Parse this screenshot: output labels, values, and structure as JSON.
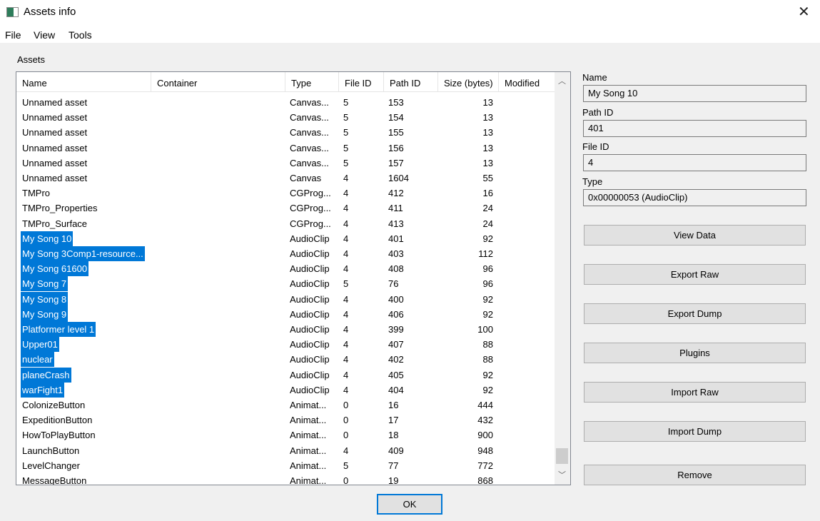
{
  "window": {
    "title": "Assets info",
    "close": "✕"
  },
  "menu": [
    "File",
    "View",
    "Tools"
  ],
  "group_label": "Assets",
  "columns": [
    "Name",
    "Container",
    "Type",
    "File ID",
    "Path ID",
    "Size (bytes)",
    "Modified"
  ],
  "rows": [
    {
      "name": "Unnamed asset",
      "container": "",
      "type": "Canvas...",
      "file_id": "5",
      "path_id": "153",
      "size": "13",
      "modified": "",
      "selected": false
    },
    {
      "name": "Unnamed asset",
      "container": "",
      "type": "Canvas...",
      "file_id": "5",
      "path_id": "154",
      "size": "13",
      "modified": "",
      "selected": false
    },
    {
      "name": "Unnamed asset",
      "container": "",
      "type": "Canvas...",
      "file_id": "5",
      "path_id": "155",
      "size": "13",
      "modified": "",
      "selected": false
    },
    {
      "name": "Unnamed asset",
      "container": "",
      "type": "Canvas...",
      "file_id": "5",
      "path_id": "156",
      "size": "13",
      "modified": "",
      "selected": false
    },
    {
      "name": "Unnamed asset",
      "container": "",
      "type": "Canvas...",
      "file_id": "5",
      "path_id": "157",
      "size": "13",
      "modified": "",
      "selected": false
    },
    {
      "name": "Unnamed asset",
      "container": "",
      "type": "Canvas",
      "file_id": "4",
      "path_id": "1604",
      "size": "55",
      "modified": "",
      "selected": false
    },
    {
      "name": "TMPro",
      "container": "",
      "type": "CGProg...",
      "file_id": "4",
      "path_id": "412",
      "size": "16",
      "modified": "",
      "selected": false
    },
    {
      "name": "TMPro_Properties",
      "container": "",
      "type": "CGProg...",
      "file_id": "4",
      "path_id": "411",
      "size": "24",
      "modified": "",
      "selected": false
    },
    {
      "name": "TMPro_Surface",
      "container": "",
      "type": "CGProg...",
      "file_id": "4",
      "path_id": "413",
      "size": "24",
      "modified": "",
      "selected": false
    },
    {
      "name": "My Song 10",
      "container": "",
      "type": "AudioClip",
      "file_id": "4",
      "path_id": "401",
      "size": "92",
      "modified": "",
      "selected": true
    },
    {
      "name": "My Song 3Comp1-resource...",
      "container": "",
      "type": "AudioClip",
      "file_id": "4",
      "path_id": "403",
      "size": "112",
      "modified": "",
      "selected": true
    },
    {
      "name": "My Song 61600",
      "container": "",
      "type": "AudioClip",
      "file_id": "4",
      "path_id": "408",
      "size": "96",
      "modified": "",
      "selected": true
    },
    {
      "name": "My Song 7",
      "container": "",
      "type": "AudioClip",
      "file_id": "5",
      "path_id": "76",
      "size": "96",
      "modified": "",
      "selected": true
    },
    {
      "name": "My Song 8",
      "container": "",
      "type": "AudioClip",
      "file_id": "4",
      "path_id": "400",
      "size": "92",
      "modified": "",
      "selected": true
    },
    {
      "name": "My Song 9",
      "container": "",
      "type": "AudioClip",
      "file_id": "4",
      "path_id": "406",
      "size": "92",
      "modified": "",
      "selected": true
    },
    {
      "name": "Platformer level 1",
      "container": "",
      "type": "AudioClip",
      "file_id": "4",
      "path_id": "399",
      "size": "100",
      "modified": "",
      "selected": true
    },
    {
      "name": "Upper01",
      "container": "",
      "type": "AudioClip",
      "file_id": "4",
      "path_id": "407",
      "size": "88",
      "modified": "",
      "selected": true
    },
    {
      "name": "nuclear",
      "container": "",
      "type": "AudioClip",
      "file_id": "4",
      "path_id": "402",
      "size": "88",
      "modified": "",
      "selected": true
    },
    {
      "name": "planeCrash",
      "container": "",
      "type": "AudioClip",
      "file_id": "4",
      "path_id": "405",
      "size": "92",
      "modified": "",
      "selected": true
    },
    {
      "name": "warFight1",
      "container": "",
      "type": "AudioClip",
      "file_id": "4",
      "path_id": "404",
      "size": "92",
      "modified": "",
      "selected": true
    },
    {
      "name": "ColonizeButton",
      "container": "",
      "type": "Animat...",
      "file_id": "0",
      "path_id": "16",
      "size": "444",
      "modified": "",
      "selected": false
    },
    {
      "name": "ExpeditionButton",
      "container": "",
      "type": "Animat...",
      "file_id": "0",
      "path_id": "17",
      "size": "432",
      "modified": "",
      "selected": false
    },
    {
      "name": "HowToPlayButton",
      "container": "",
      "type": "Animat...",
      "file_id": "0",
      "path_id": "18",
      "size": "900",
      "modified": "",
      "selected": false
    },
    {
      "name": "LaunchButton",
      "container": "",
      "type": "Animat...",
      "file_id": "4",
      "path_id": "409",
      "size": "948",
      "modified": "",
      "selected": false
    },
    {
      "name": "LevelChanger",
      "container": "",
      "type": "Animat...",
      "file_id": "5",
      "path_id": "77",
      "size": "772",
      "modified": "",
      "selected": false
    },
    {
      "name": "MessageButton",
      "container": "",
      "type": "Animat...",
      "file_id": "0",
      "path_id": "19",
      "size": "868",
      "modified": "",
      "selected": false
    }
  ],
  "details": {
    "name_label": "Name",
    "name_value": "My Song 10",
    "path_label": "Path ID",
    "path_value": "401",
    "file_label": "File ID",
    "file_value": "4",
    "type_label": "Type",
    "type_value": "0x00000053 (AudioClip)"
  },
  "buttons": [
    "View Data",
    "Export Raw",
    "Export Dump",
    "Plugins",
    "Import Raw",
    "Import Dump",
    "Remove"
  ],
  "ok": "OK",
  "colors": {
    "selection": "#0078d7"
  }
}
